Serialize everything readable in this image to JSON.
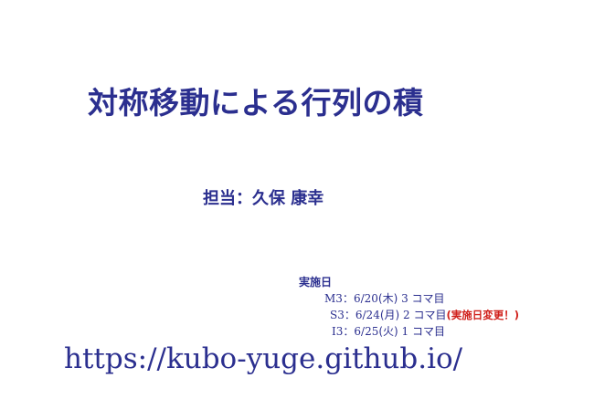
{
  "slide": {
    "title": "対称移動による行列の積",
    "presenter": "担当：久保 康幸",
    "schedule": {
      "heading": "実施日",
      "rows": [
        {
          "class_code": "M3",
          "sep": "：",
          "date": "6/20",
          "day": "(木)",
          "period": " 3 ",
          "unit": "コマ目",
          "note": ""
        },
        {
          "class_code": "S3",
          "sep": "：",
          "date": "6/24",
          "day": "(月)",
          "period": " 2 ",
          "unit": "コマ目",
          "note": "(実施日変更！)"
        },
        {
          "class_code": "I3",
          "sep": "：",
          "date": "6/25",
          "day": "(火)",
          "period": " 1 ",
          "unit": "コマ目",
          "note": ""
        }
      ]
    },
    "url": "https://kubo-yuge.github.io/"
  },
  "colors": {
    "primary": "#2b2f8f",
    "alert": "#d0201b",
    "background": "#ffffff"
  }
}
